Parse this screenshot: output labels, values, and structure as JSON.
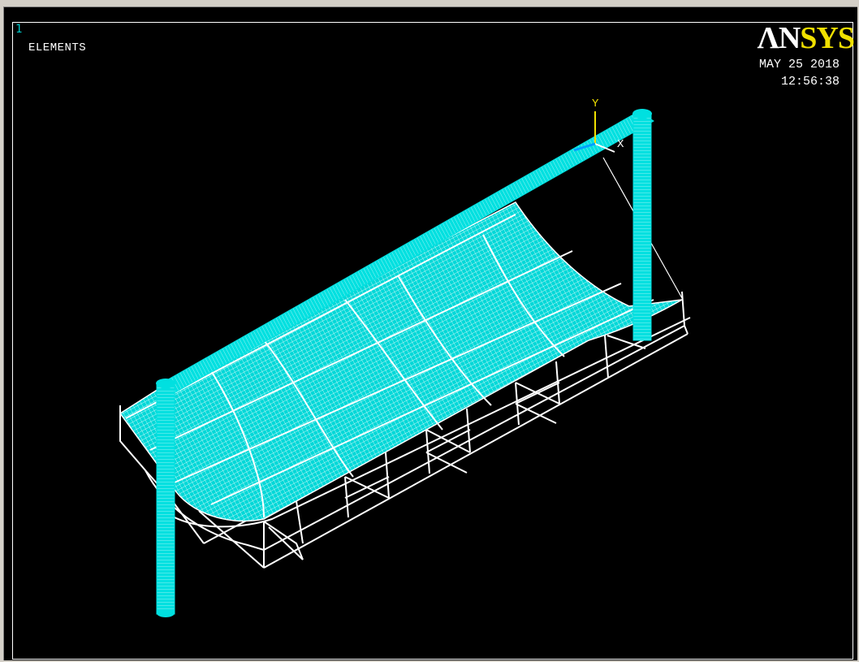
{
  "window": {
    "number": "1",
    "plot_label": "ELEMENTS"
  },
  "logo": {
    "part1": "ΛN",
    "part2": "SYS"
  },
  "timestamp": {
    "date": "MAY 25 2018",
    "time": "12:56:38"
  },
  "triad": {
    "y_label": "Y",
    "x_label": "X"
  },
  "colors": {
    "background": "#000000",
    "mesh": "#00e0e0",
    "frame": "#ffffff",
    "logo_accent": "#f0e000"
  }
}
